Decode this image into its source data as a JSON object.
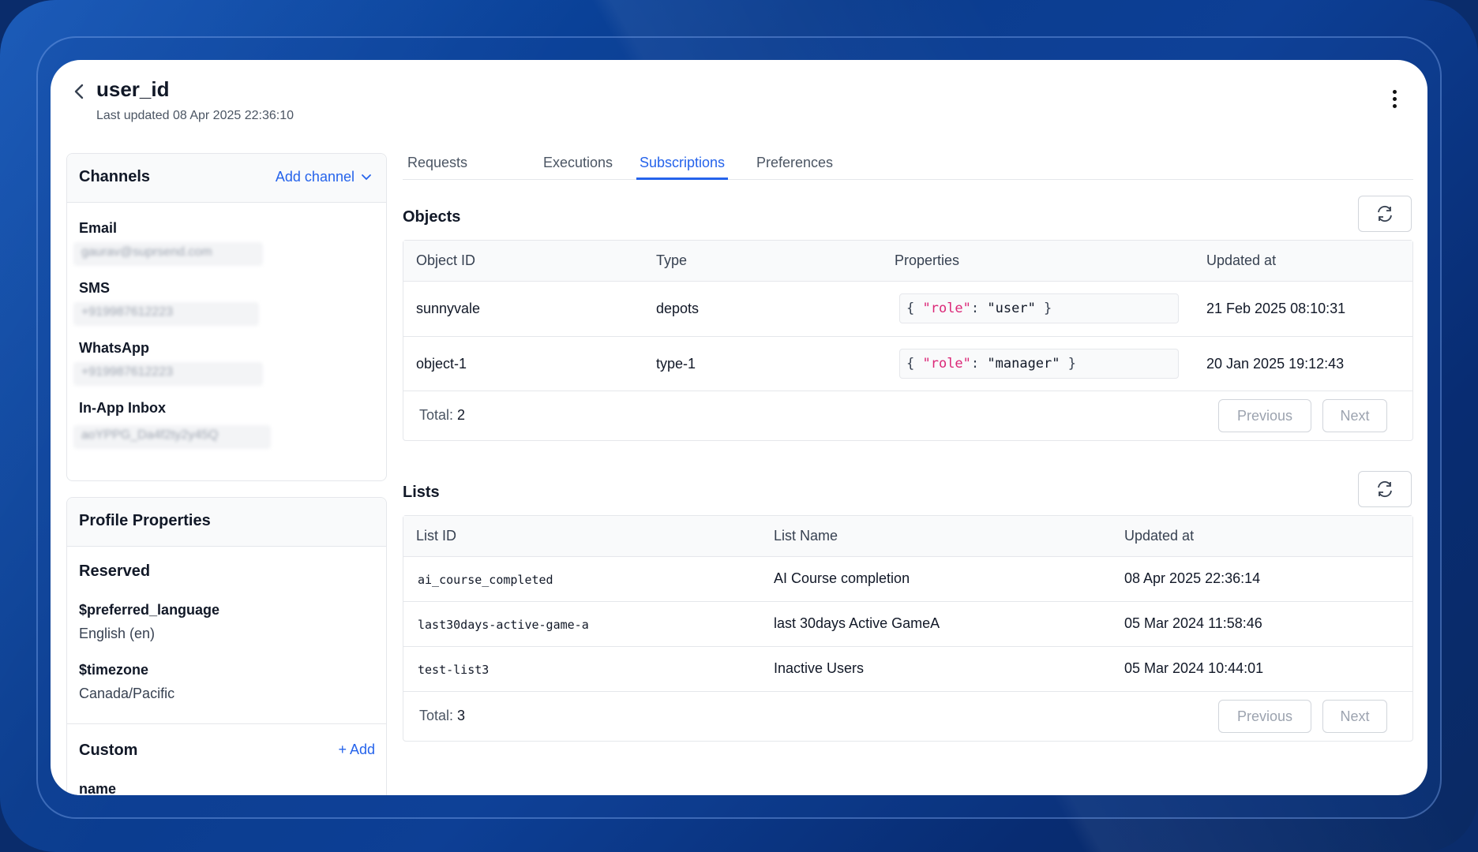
{
  "header": {
    "title": "user_id",
    "subtitle": "Last updated 08 Apr 2025 22:36:10"
  },
  "channels": {
    "title": "Channels",
    "add_label": "Add channel",
    "items": [
      {
        "label": "Email",
        "value": "gaurav@suprsend.com"
      },
      {
        "label": "SMS",
        "value": "+919987612223"
      },
      {
        "label": "WhatsApp",
        "value": "+919987612223"
      },
      {
        "label": "In-App Inbox",
        "value": "aoYPPG_Da4f2ty2y45Q"
      }
    ]
  },
  "profile": {
    "title": "Profile Properties",
    "reserved_title": "Reserved",
    "reserved": [
      {
        "key": "$preferred_language",
        "value": "English (en)"
      },
      {
        "key": "$timezone",
        "value": "Canada/Pacific"
      }
    ],
    "custom_title": "Custom",
    "custom_add": "Add",
    "custom": [
      {
        "key": "name"
      }
    ]
  },
  "tabs": [
    "Requests",
    "Executions",
    "Subscriptions",
    "Preferences"
  ],
  "active_tab": "Subscriptions",
  "objects": {
    "title": "Objects",
    "columns": [
      "Object ID",
      "Type",
      "Properties",
      "Updated at"
    ],
    "rows": [
      {
        "id": "sunnyvale",
        "type": "depots",
        "prop_key": "\"role\"",
        "prop_val": "\"user\"",
        "updated": "21 Feb 2025 08:10:31"
      },
      {
        "id": "object-1",
        "type": "type-1",
        "prop_key": "\"role\"",
        "prop_val": "\"manager\"",
        "updated": "20 Jan 2025 19:12:43"
      }
    ],
    "total_label": "Total:",
    "total": "2",
    "prev": "Previous",
    "next": "Next"
  },
  "lists": {
    "title": "Lists",
    "columns": [
      "List ID",
      "List Name",
      "Updated at"
    ],
    "rows": [
      {
        "id": "ai_course_completed",
        "name": "AI Course completion",
        "updated": "08 Apr 2025 22:36:14"
      },
      {
        "id": "last30days-active-game-a",
        "name": "last 30days Active GameA",
        "updated": "05 Mar 2024 11:58:46"
      },
      {
        "id": "test-list3",
        "name": "Inactive Users",
        "updated": "05 Mar 2024 10:44:01"
      }
    ],
    "total_label": "Total:",
    "total": "3",
    "prev": "Previous",
    "next": "Next"
  },
  "colors": {
    "accent": "#2563eb",
    "json_key": "#db2777"
  },
  "icons": [
    "back-chevron-icon",
    "more-vertical-icon",
    "chevron-down-icon",
    "plus-icon",
    "refresh-icon"
  ]
}
